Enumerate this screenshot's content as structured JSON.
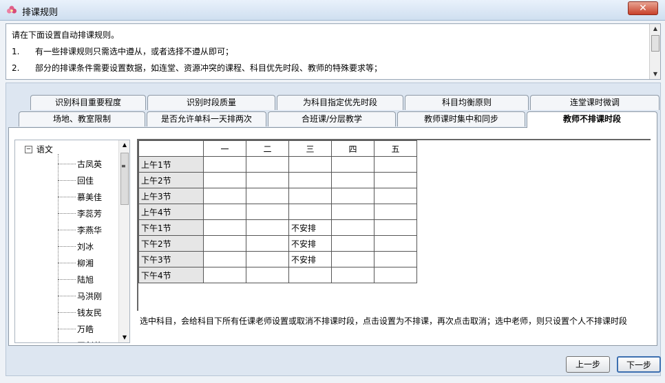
{
  "window": {
    "title": "排课规则",
    "close_label": "✕"
  },
  "intro": {
    "lines": [
      {
        "num": "",
        "text": "请在下面设置自动排课规则。"
      },
      {
        "num": "1.",
        "text": "有一些排课规则只需选中遵从，或者选择不遵从即可；"
      },
      {
        "num": "2.",
        "text": "部分的排课条件需要设置数据，如连堂、资源冲突的课程、科目优先时段、教师的特殊要求等；"
      }
    ]
  },
  "tabs": {
    "row1": [
      "识别科目重要程度",
      "识别时段质量",
      "为科目指定优先时段",
      "科目均衡原则",
      "连堂课时微调"
    ],
    "row2": [
      "场地、教室限制",
      "是否允许单科一天排两次",
      "合班课/分层教学",
      "教师课时集中和同步",
      "教师不排课时段"
    ]
  },
  "tree": {
    "root": "语文",
    "expander": "−",
    "teachers": [
      "古凤英",
      "回佳",
      "慕美佳",
      "李蕊芳",
      "李燕华",
      "刘冰",
      "柳湘",
      "陆旭",
      "马洪刚",
      "钱友民",
      "万皓",
      "王剑英"
    ]
  },
  "schedule": {
    "days": [
      "一",
      "二",
      "三",
      "四",
      "五"
    ],
    "periods": [
      "上午1节",
      "上午2节",
      "上午3节",
      "上午4节",
      "下午1节",
      "下午2节",
      "下午3节",
      "下午4节"
    ],
    "cells": [
      [
        "",
        "",
        "",
        "",
        ""
      ],
      [
        "",
        "",
        "",
        "",
        ""
      ],
      [
        "",
        "",
        "",
        "",
        ""
      ],
      [
        "",
        "",
        "",
        "",
        ""
      ],
      [
        "",
        "",
        "不安排",
        "",
        ""
      ],
      [
        "",
        "",
        "不安排",
        "",
        ""
      ],
      [
        "",
        "",
        "不安排",
        "",
        ""
      ],
      [
        "",
        "",
        "",
        "",
        ""
      ]
    ]
  },
  "hint": "选中科目，会给科目下所有任课老师设置或取消不排课时段，点击设置为不排课，再次点击取消；选中老师，则只设置个人不排课时段",
  "buttons": {
    "prev": "上一步",
    "next": "下一步"
  }
}
